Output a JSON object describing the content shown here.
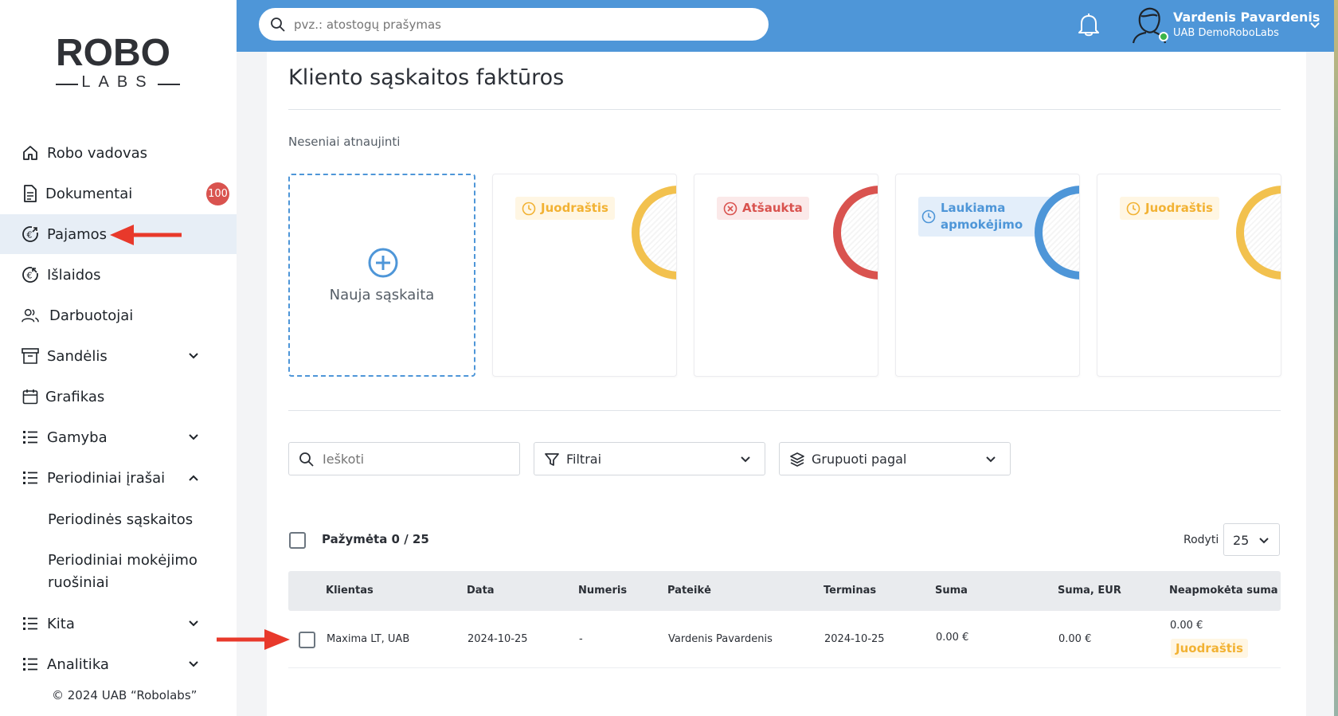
{
  "sidebar": {
    "logo_top": "ROBO",
    "logo_bottom": "LABS",
    "items": [
      {
        "label": "Robo vadovas"
      },
      {
        "label": "Dokumentai",
        "badge": "100"
      },
      {
        "label": "Pajamos"
      },
      {
        "label": "Išlaidos"
      },
      {
        "label": "Darbuotojai"
      },
      {
        "label": "Sandėlis"
      },
      {
        "label": "Grafikas"
      },
      {
        "label": "Gamyba"
      },
      {
        "label": "Periodiniai įrašai"
      },
      {
        "label": "Kita"
      },
      {
        "label": "Analitika"
      }
    ],
    "sub_items": [
      {
        "label": "Periodinės sąskaitos"
      },
      {
        "label": "Periodiniai mokėjimo ruošiniai"
      }
    ],
    "copyright": "© 2024 UAB “Robolabs”"
  },
  "topbar": {
    "search_placeholder": "pvz.: atostogų prašymas",
    "user_name": "Vardenis Pavardenis",
    "company": "UAB DemoRoboLabs"
  },
  "main": {
    "title": "Kliento sąskaitos faktūros",
    "recent_label": "Neseniai atnaujinti",
    "new_invoice_label": "Nauja sąskaita",
    "recent_cards": [
      {
        "status": "Juodraštis",
        "color": "#f2c14e"
      },
      {
        "status": "Atšaukta",
        "color": "#d9534f"
      },
      {
        "status": "Laukiama apmokėjimo",
        "color": "#4e96d8"
      },
      {
        "status": "Juodraštis",
        "color": "#f2c14e"
      }
    ],
    "search_placeholder": "Ieškoti",
    "filters_label": "Filtrai",
    "group_label": "Grupuoti pagal",
    "selected": "Pažymėta 0 / 25",
    "show_label": "Rodyti",
    "show_value": "25",
    "columns": [
      "Klientas",
      "Data",
      "Numeris",
      "Pateikė",
      "Terminas",
      "Suma",
      "Suma, EUR",
      "Neapmokėta suma"
    ],
    "rows": [
      {
        "client": "Maxima LT, UAB",
        "date": "2024-10-25",
        "number": "-",
        "submitted_by": "Vardenis Pavardenis",
        "due": "2024-10-25",
        "amount": "0.00 €",
        "amount_eur": "0.00 €",
        "unpaid": "0.00 €",
        "status": "Juodraštis"
      }
    ]
  },
  "colors": {
    "accent": "#4e96d8",
    "badge": "#d9534f",
    "draft": "#f2b233",
    "cancel": "#d9534f",
    "arrow": "#e8392b"
  }
}
